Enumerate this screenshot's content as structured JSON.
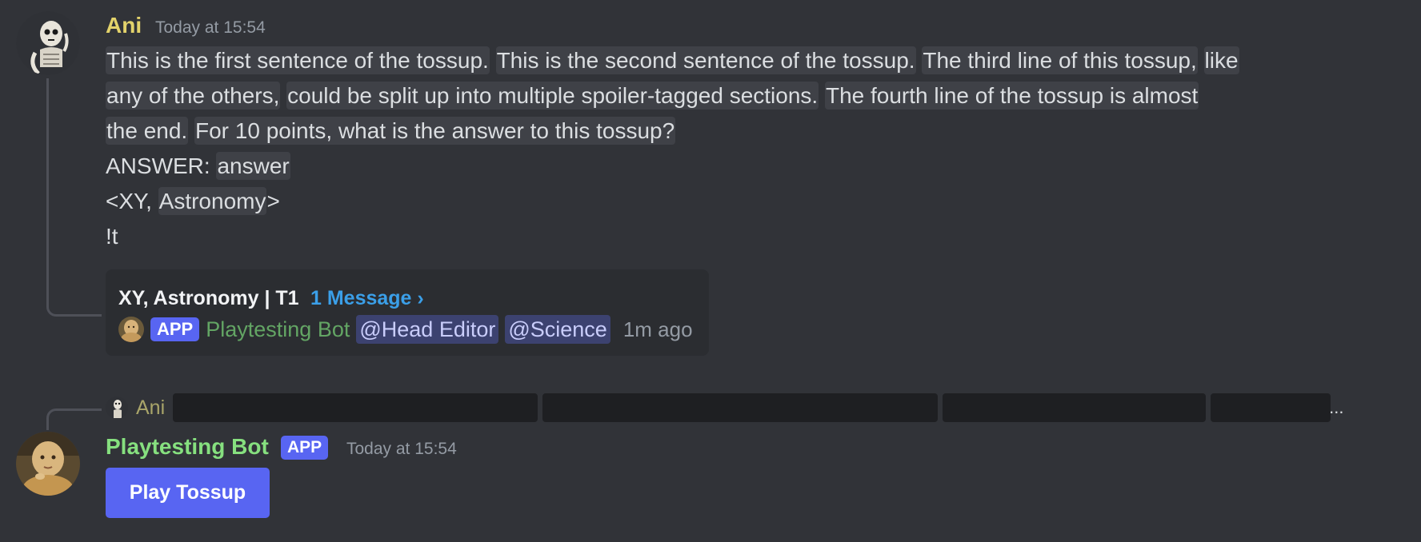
{
  "message1": {
    "author": "Ani",
    "timestamp": "Today at 15:54",
    "lines": {
      "l1": [
        "This is the first sentence of the tossup.",
        "This is the second sentence of the tossup.",
        "The third line of this tossup,",
        "like"
      ],
      "l2": [
        "any of the others,",
        "could be split up into multiple spoiler-tagged sections.",
        "The fourth line of the tossup is almost"
      ],
      "l3": [
        "the end.",
        "For 10 points, what is the answer to this tossup?"
      ],
      "answer_label": "ANSWER: ",
      "answer_value": "answer",
      "category_prefix": "<XY, ",
      "category_value": "Astronomy",
      "category_suffix": ">",
      "command": "!t"
    },
    "thread": {
      "title": "XY, Astronomy | T1",
      "message_count": "1 Message ›",
      "app_badge": "APP",
      "bot_name": "Playtesting Bot",
      "mention_1": "@Head Editor",
      "mention_2": "@Science",
      "time_ago": "1m ago"
    }
  },
  "reply_preview": {
    "author": "Ani",
    "ellipsis": "..."
  },
  "message2": {
    "author": "Playtesting Bot",
    "app_badge": "APP",
    "timestamp": "Today at 15:54",
    "button_label": "Play Tossup"
  },
  "colors": {
    "background": "#313338",
    "ani_name": "#e3d36b",
    "bot_name": "#86e07f",
    "blurple": "#5865f2",
    "link_blue": "#3b9fe8"
  }
}
